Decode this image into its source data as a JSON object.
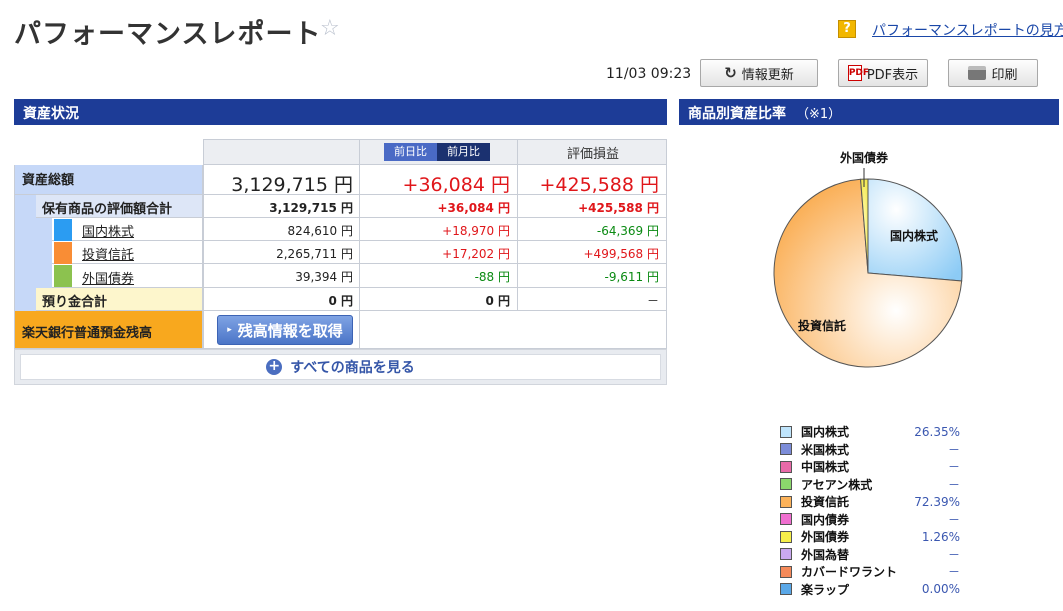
{
  "header": {
    "title": "パフォーマンスレポート",
    "help_icon": "?",
    "help_link": "パフォーマンスレポートの見方"
  },
  "toolbar": {
    "timestamp": "11/03 09:23",
    "refresh_label": "情報更新",
    "pdf_icon": "PDF",
    "pdf_label": "PDF表示",
    "print_label": "印刷"
  },
  "assets": {
    "section_title": "資産状況",
    "tabs": [
      "前日比",
      "前月比"
    ],
    "selected_tab": "前月比",
    "col_eval": "評価損益",
    "total": {
      "label": "資産総額",
      "value": "3,129,715 円",
      "change": "+36,084 円",
      "gain": "+425,588 円"
    },
    "holdings": {
      "label": "保有商品の評価額合計",
      "value": "3,129,715 円",
      "change": "+36,084 円",
      "gain": "+425,588 円"
    },
    "products": [
      {
        "name": "国内株式",
        "value": "824,610 円",
        "change": "+18,970 円",
        "gain": "-64,369 円",
        "color": "#2b9cf2"
      },
      {
        "name": "投資信託",
        "value": "2,265,711 円",
        "change": "+17,202 円",
        "gain": "+499,568 円",
        "color": "#f98d35"
      },
      {
        "name": "外国債券",
        "value": "39,394 円",
        "change": "-88 円",
        "gain": "-9,611 円",
        "color": "#8cc24f"
      }
    ],
    "deposit": {
      "label": "預り金合計",
      "value": "0 円",
      "change": "0 円",
      "gain": "－"
    },
    "bank": {
      "label": "楽天銀行普通預金残高",
      "button": "残高情報を取得"
    },
    "view_all": "すべての商品を見る"
  },
  "ratio": {
    "section_title": "商品別資産比率",
    "note": "（※1）",
    "chart_data": {
      "type": "pie",
      "labels": [
        "国内株式",
        "投資信託",
        "外国債券"
      ],
      "values": [
        26.35,
        72.39,
        1.26
      ],
      "colors": [
        "#a8d8f8",
        "#fbb25a",
        "#f2ea40"
      ]
    },
    "legend": [
      {
        "name": "国内株式",
        "value": "26.35%",
        "color": "#bfe4fb"
      },
      {
        "name": "米国株式",
        "value": "－",
        "color": "#7c8cd8"
      },
      {
        "name": "中国株式",
        "value": "－",
        "color": "#e86aa8"
      },
      {
        "name": "アセアン株式",
        "value": "－",
        "color": "#8bd86c"
      },
      {
        "name": "投資信託",
        "value": "72.39%",
        "color": "#fbb25a"
      },
      {
        "name": "国内債券",
        "value": "－",
        "color": "#f06fd0"
      },
      {
        "name": "外国債券",
        "value": "1.26%",
        "color": "#f6ef4a"
      },
      {
        "name": "外国為替",
        "value": "－",
        "color": "#c9a8f0"
      },
      {
        "name": "カバードワラント",
        "value": "－",
        "color": "#f58a5a"
      },
      {
        "name": "楽ラップ",
        "value": "0.00%",
        "color": "#5aa8e8"
      }
    ]
  }
}
